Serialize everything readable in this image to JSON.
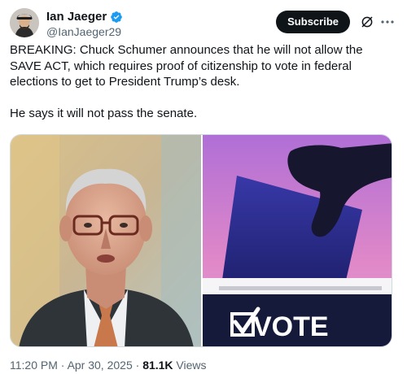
{
  "author": {
    "display_name": "Ian Jaeger",
    "handle": "@IanJaeger29",
    "verified": true
  },
  "actions": {
    "subscribe_label": "Subscribe",
    "grok_icon": "grok-icon",
    "more_icon": "more-icon"
  },
  "tweet": {
    "paragraph_1": "BREAKING: Chuck Schumer announces that he will not allow the SAVE ACT, which requires proof of citizenship to vote in federal elections to get to President Trump’s desk.",
    "paragraph_2": "He says it will not pass the senate."
  },
  "media": {
    "left_description": "photo-portrait",
    "right": {
      "ballot_label": "VOTE",
      "checkbox_icon": "checkmark-icon",
      "colors": {
        "background": "#e088c8",
        "ballot": "#2a2a8a",
        "box": "#151a3a"
      }
    }
  },
  "meta": {
    "time": "11:20 PM",
    "separator": " · ",
    "date": "Apr 30, 2025",
    "views_count": "81.1K",
    "views_label": " Views"
  },
  "colors": {
    "text": "#0f1419",
    "secondary": "#536471",
    "verified": "#1d9bf0"
  }
}
